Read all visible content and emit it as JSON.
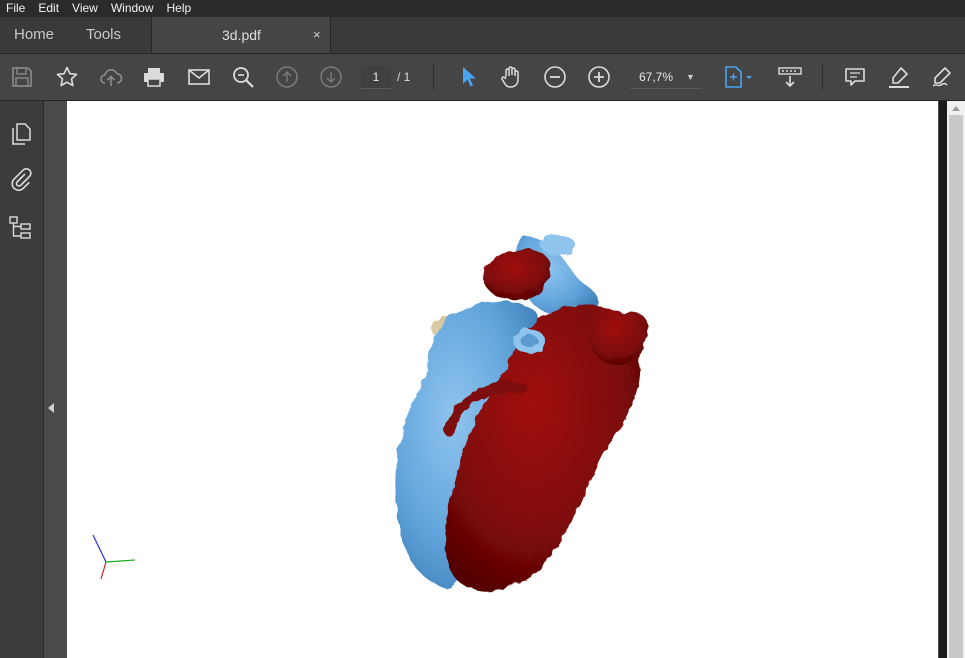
{
  "menu": [
    "File",
    "Edit",
    "View",
    "Window",
    "Help"
  ],
  "tabs": {
    "home": "Home",
    "tools": "Tools",
    "document": "3d.pdf",
    "close": "×"
  },
  "toolbar": {
    "page_current": "1",
    "page_total": "/ 1",
    "zoom": "67,7%",
    "icons": [
      "save-icon",
      "bookmark-star-icon",
      "cloud-upload-icon",
      "print-icon",
      "email-icon",
      "search-zoom-icon",
      "page-up-icon",
      "page-down-icon",
      "select-cursor-icon",
      "hand-icon",
      "zoom-out-icon",
      "zoom-in-icon",
      "fit-page-icon",
      "scroll-mode-icon",
      "comment-icon",
      "highlight-icon",
      "sign-icon"
    ]
  },
  "left_panel": [
    "pages-icon",
    "attachments-icon",
    "structure-icon"
  ],
  "colors": {
    "accent": "#4aa3f0",
    "heart_blue": "#6aaee2",
    "heart_red": "#8b0a0a",
    "background": "#323232"
  }
}
